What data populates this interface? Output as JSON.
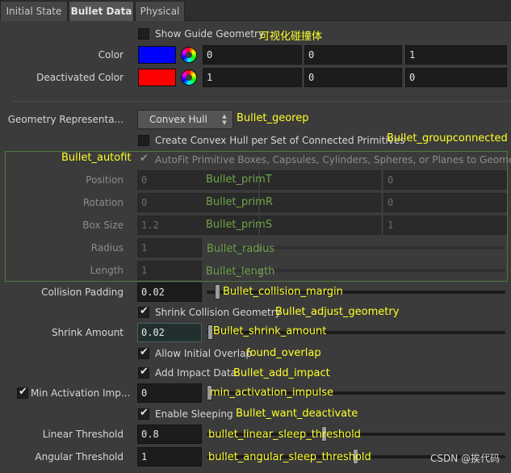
{
  "tabs": [
    "Initial State",
    "Bullet Data",
    "Physical"
  ],
  "colors": {
    "color_swatch": "#0000ff",
    "deactivated_swatch": "#ff0000",
    "note_yellow": "#ffff2a",
    "note_green": "#6ea64a"
  },
  "show_guide": {
    "label": "Show Guide Geometry",
    "checked": false,
    "note": "可视化碰撞体"
  },
  "color": {
    "label": "Color",
    "values": [
      "0",
      "0",
      "1"
    ]
  },
  "deactivated_color": {
    "label": "Deactivated Color",
    "values": [
      "1",
      "0",
      "0"
    ]
  },
  "geo_rep": {
    "label": "Geometry Representa...",
    "value": "Convex Hull",
    "note": "Bullet_georep"
  },
  "convex_hull": {
    "label": "Create Convex Hull per Set of Connected Primitives",
    "checked": false,
    "note": "Bullet_groupconnected"
  },
  "autofit": {
    "label": "AutoFit Primitive Boxes, Capsules, Cylinders, Spheres, or Planes to Geometry",
    "checked": true,
    "note": "Bullet_autofit"
  },
  "position": {
    "label": "Position",
    "values": [
      "0",
      "",
      "0"
    ],
    "note": "Bullet_primT"
  },
  "rotation": {
    "label": "Rotation",
    "values": [
      "0",
      "",
      "0"
    ],
    "note": "Bullet_primR"
  },
  "box_size": {
    "label": "Box Size",
    "values": [
      "1.2",
      "",
      "1"
    ],
    "note": "Bullet_primS"
  },
  "radius": {
    "label": "Radius",
    "value": "1",
    "note": "Bullet_radius"
  },
  "length": {
    "label": "Length",
    "value": "1",
    "note": "Bullet_length"
  },
  "collision_padding": {
    "label": "Collision Padding",
    "value": "0.02",
    "note": "Bullet_collision_margin",
    "slider": 0.02
  },
  "shrink_geo": {
    "label": "Shrink Collision Geometry",
    "checked": true,
    "note": "Bullet_adjust_geometry"
  },
  "shrink_amount": {
    "label": "Shrink Amount",
    "value": "0.02",
    "note": "Bullet_shrink_amount",
    "slider": 0.02
  },
  "initial_overlap": {
    "label": "Allow Initial Overlap",
    "checked": true,
    "note": "found_overlap"
  },
  "impact_data": {
    "label": "Add Impact Data",
    "checked": true,
    "note": "Bullet_add_impact"
  },
  "min_activation": {
    "label": "Min Activation Imp...",
    "checked": true,
    "value": "0",
    "note": "min_activation_impulse",
    "slider": 0
  },
  "sleeping": {
    "label": "Enable Sleeping",
    "checked": true,
    "note": "Bullet_want_deactivate"
  },
  "linear_threshold": {
    "label": "Linear Threshold",
    "value": "0.8",
    "note": "bullet_linear_sleep_threshold",
    "slider": 0.4
  },
  "angular_threshold": {
    "label": "Angular Threshold",
    "value": "1",
    "note": "bullet_angular_sleep_threshold",
    "slider": 0.5
  },
  "watermark": "CSDN @挨代码"
}
